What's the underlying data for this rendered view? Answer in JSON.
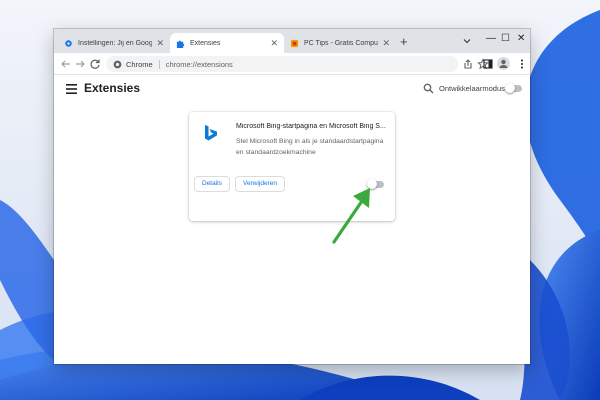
{
  "tabs": [
    {
      "title": "Instellingen: Jij en Google",
      "favicon": "settings-gear-icon",
      "active": false
    },
    {
      "title": "Extensies",
      "favicon": "puzzle-piece-icon",
      "active": true
    },
    {
      "title": "PC Tips - Gratis Computer T",
      "favicon": "pc-tips-icon",
      "active": false
    }
  ],
  "toolbar": {
    "scheme_label": "Chrome",
    "url": "chrome://extensions"
  },
  "page": {
    "title": "Extensies",
    "devmode_label": "Ontwikkelaarmodus",
    "devmode_on": false
  },
  "extension": {
    "name": "Microsoft Bing-startpagina en Microsoft Bing S...",
    "description": "Stel Microsoft Bing in als je standaardstartpagina en standaardzoekmachine",
    "details_label": "Details",
    "remove_label": "Verwijderen",
    "enabled": false,
    "icon": "bing-logo-icon"
  },
  "colors": {
    "accent": "#1a73e8",
    "bing": "#0a7bd8",
    "arrow": "#3aaa3a",
    "wallpaper": "#0a4fd6"
  }
}
